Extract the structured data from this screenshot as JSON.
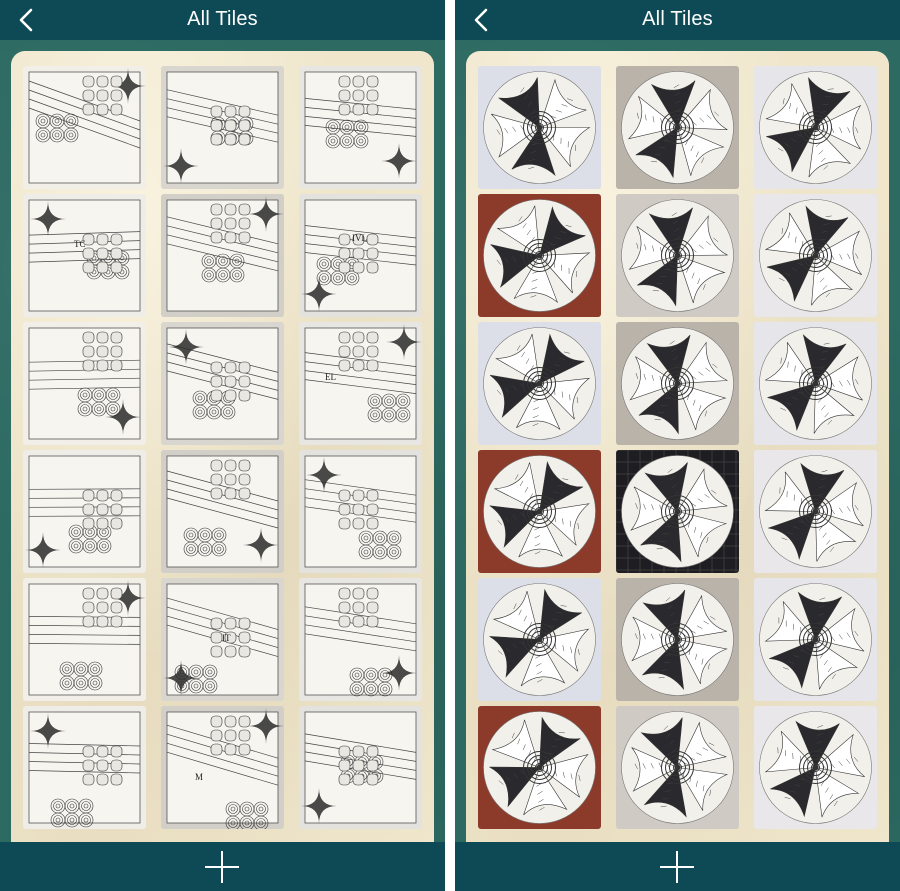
{
  "colors": {
    "navbar": "#0d4a55",
    "background_green": "#2c6a62",
    "paper": "#efe6cc",
    "nav_text": "#ffffff"
  },
  "icons": {
    "back": "chevron-left-icon",
    "add": "plus-icon"
  },
  "screens": [
    {
      "title": "All Tiles",
      "tile_style": "square",
      "tiles": [
        {
          "caption": ""
        },
        {
          "caption": ""
        },
        {
          "caption": ""
        },
        {
          "caption": "TC"
        },
        {
          "caption": ""
        },
        {
          "caption": "IVL"
        },
        {
          "caption": ""
        },
        {
          "caption": ""
        },
        {
          "caption": "EL"
        },
        {
          "caption": ""
        },
        {
          "caption": ""
        },
        {
          "caption": ""
        },
        {
          "caption": ""
        },
        {
          "caption": "IT"
        },
        {
          "caption": ""
        },
        {
          "caption": ""
        },
        {
          "caption": "M"
        },
        {
          "caption": ""
        }
      ]
    },
    {
      "title": "All Tiles",
      "tile_style": "round",
      "tiles": [
        {
          "caption": ""
        },
        {
          "caption": ""
        },
        {
          "caption": ""
        },
        {
          "caption": ""
        },
        {
          "caption": ""
        },
        {
          "caption": ""
        },
        {
          "caption": ""
        },
        {
          "caption": ""
        },
        {
          "caption": ""
        },
        {
          "caption": ""
        },
        {
          "caption": ""
        },
        {
          "caption": ""
        },
        {
          "caption": ""
        },
        {
          "caption": ""
        },
        {
          "caption": ""
        },
        {
          "caption": ""
        },
        {
          "caption": ""
        },
        {
          "caption": ""
        }
      ]
    }
  ]
}
